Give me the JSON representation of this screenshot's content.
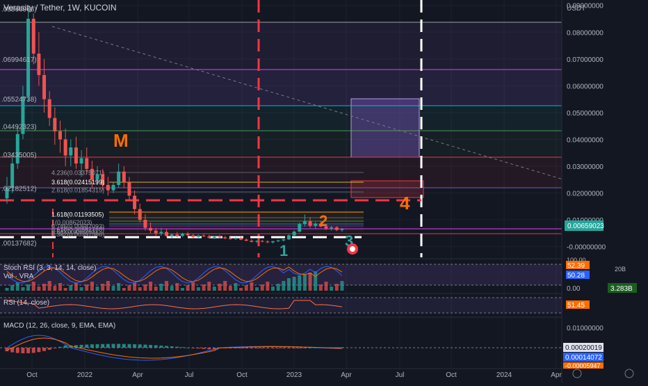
{
  "header": {
    "title": "Verasity / Tether, 1W, KUCOIN",
    "currency": "USDT"
  },
  "colors": {
    "bg": "#131722",
    "grid": "#1e222d",
    "up": "#26a69a",
    "down": "#ef5350",
    "text": "#b2b5be",
    "purple": "#7e57c2",
    "orange": "#ff9800",
    "red": "#f23645",
    "white": "#ffffff",
    "green": "#4caf50",
    "blueLine": "#2962ff",
    "macdSignal": "#ff6d00"
  },
  "left_labels": [
    {
      "text": ".08866963)",
      "price": 0.0887
    },
    {
      "text": ".06994617)",
      "price": 0.07
    },
    {
      "text": ".05524738)",
      "price": 0.0552
    },
    {
      "text": ".04492323)",
      "price": 0.0449
    },
    {
      "text": ".03435005)",
      "price": 0.0344
    },
    {
      "text": ".02182512)",
      "price": 0.0218
    },
    {
      "text": ".00137682)",
      "price": 0.0014
    }
  ],
  "fib_labels": [
    {
      "text": "4.236(0.03375071)",
      "price": 0.0275
    },
    {
      "text": "3.618(0.02415199)",
      "price": 0.024
    },
    {
      "text": "2.618(0.01854315)",
      "price": 0.021
    },
    {
      "text": "1.618(0.01193505)",
      "price": 0.0119
    },
    {
      "text": "1(0.00862023)",
      "price": 0.009
    },
    {
      "text": "0.786(0.00687093)",
      "price": 0.0075
    },
    {
      "text": "0.618(0.00582798)",
      "price": 0.0064
    },
    {
      "text": "0.5(0.00490203)",
      "price": 0.0055
    },
    {
      "text": "0.382(0.00397598)",
      "price": 0.0045
    }
  ],
  "annotations": {
    "m": "M",
    "n1": "1",
    "n2": "2",
    "n3": "3",
    "n4": "4"
  },
  "price_axis": {
    "ticks": [
      "0.09000000",
      "0.08000000",
      "0.07000000",
      "0.06000000",
      "0.05000000",
      "0.04000000",
      "0.03000000",
      "0.02000000",
      "0.01000000",
      "-0.00000000"
    ],
    "last_price": "0.00659023"
  },
  "time_axis": [
    "Oct",
    "2022",
    "Apr",
    "Jul",
    "Oct",
    "2023",
    "Apr",
    "Jul",
    "Oct",
    "2024",
    "Apr"
  ],
  "indicators": {
    "stoch_label": "Stoch RSI (3, 3, 14, 14, close)",
    "stoch_top": "100.00",
    "stoch_k": "52.39",
    "stoch_d": "50.28",
    "vol_label": "Vol · VRA",
    "vol_scale": "20B",
    "vol_zero": "0.00",
    "vol_value": "3.283B",
    "rsi_label": "RSI (14, close)",
    "rsi_value": "51.45",
    "macd_label": "MACD (12, 26, close, 9, EMA, EMA)",
    "macd_scale": "0.01000000",
    "macd_v1": "0.00020019",
    "macd_v2": "0.00014072",
    "macd_v3": "-0.00005947"
  },
  "chart_data": {
    "type": "candlestick",
    "title": "Verasity / Tether, 1W, KUCOIN",
    "ylabel": "USDT",
    "ylim": [
      -0.004,
      0.092
    ],
    "x_range": [
      "2021-09",
      "2024-04"
    ],
    "candles": [
      [
        0.018,
        0.026,
        0.016,
        0.022
      ],
      [
        0.022,
        0.035,
        0.02,
        0.031
      ],
      [
        0.031,
        0.045,
        0.029,
        0.042
      ],
      [
        0.042,
        0.06,
        0.04,
        0.056
      ],
      [
        0.056,
        0.089,
        0.054,
        0.085
      ],
      [
        0.085,
        0.087,
        0.068,
        0.072
      ],
      [
        0.072,
        0.08,
        0.06,
        0.064
      ],
      [
        0.064,
        0.07,
        0.05,
        0.055
      ],
      [
        0.055,
        0.058,
        0.045,
        0.048
      ],
      [
        0.048,
        0.052,
        0.038,
        0.043
      ],
      [
        0.043,
        0.047,
        0.035,
        0.04
      ],
      [
        0.04,
        0.044,
        0.03,
        0.034
      ],
      [
        0.034,
        0.04,
        0.03,
        0.037
      ],
      [
        0.037,
        0.041,
        0.029,
        0.031
      ],
      [
        0.031,
        0.036,
        0.026,
        0.033
      ],
      [
        0.033,
        0.037,
        0.027,
        0.029
      ],
      [
        0.029,
        0.032,
        0.022,
        0.025
      ],
      [
        0.025,
        0.03,
        0.023,
        0.027
      ],
      [
        0.027,
        0.029,
        0.021,
        0.023
      ],
      [
        0.023,
        0.026,
        0.019,
        0.021
      ],
      [
        0.021,
        0.024,
        0.02,
        0.023
      ],
      [
        0.023,
        0.031,
        0.022,
        0.028
      ],
      [
        0.028,
        0.03,
        0.022,
        0.024
      ],
      [
        0.024,
        0.026,
        0.017,
        0.019
      ],
      [
        0.019,
        0.021,
        0.012,
        0.014
      ],
      [
        0.014,
        0.016,
        0.009,
        0.01
      ],
      [
        0.01,
        0.012,
        0.006,
        0.007
      ],
      [
        0.007,
        0.009,
        0.005,
        0.006
      ],
      [
        0.006,
        0.007,
        0.004,
        0.005
      ],
      [
        0.005,
        0.007,
        0.004,
        0.0055
      ],
      [
        0.0055,
        0.0065,
        0.0035,
        0.004
      ],
      [
        0.004,
        0.005,
        0.003,
        0.0045
      ],
      [
        0.0045,
        0.0055,
        0.0035,
        0.004
      ],
      [
        0.004,
        0.0052,
        0.0035,
        0.0048
      ],
      [
        0.0048,
        0.0055,
        0.004,
        0.0042
      ],
      [
        0.0042,
        0.0048,
        0.0032,
        0.0036
      ],
      [
        0.0036,
        0.0045,
        0.003,
        0.0041
      ],
      [
        0.0041,
        0.0047,
        0.0036,
        0.0038
      ],
      [
        0.0038,
        0.0044,
        0.0031,
        0.0033
      ],
      [
        0.0033,
        0.004,
        0.0029,
        0.0037
      ],
      [
        0.0037,
        0.0043,
        0.0032,
        0.0035
      ],
      [
        0.0035,
        0.004,
        0.0028,
        0.0031
      ],
      [
        0.0031,
        0.0036,
        0.0026,
        0.0029
      ],
      [
        0.0029,
        0.0035,
        0.0025,
        0.0032
      ],
      [
        0.0032,
        0.0036,
        0.0024,
        0.0026
      ],
      [
        0.0026,
        0.0031,
        0.002,
        0.0022
      ],
      [
        0.0022,
        0.0027,
        0.0015,
        0.0018
      ],
      [
        0.0018,
        0.0024,
        0.0014,
        0.0021
      ],
      [
        0.0021,
        0.0025,
        0.0016,
        0.0019
      ],
      [
        0.0019,
        0.0024,
        0.0013,
        0.0016
      ],
      [
        0.0016,
        0.0022,
        0.0012,
        0.002
      ],
      [
        0.002,
        0.0026,
        0.0017,
        0.0023
      ],
      [
        0.0023,
        0.0029,
        0.0019,
        0.0027
      ],
      [
        0.0027,
        0.0045,
        0.0025,
        0.0042
      ],
      [
        0.0042,
        0.006,
        0.0038,
        0.0056
      ],
      [
        0.0056,
        0.009,
        0.0052,
        0.0085
      ],
      [
        0.0085,
        0.012,
        0.0075,
        0.0095
      ],
      [
        0.0095,
        0.011,
        0.007,
        0.0078
      ],
      [
        0.0078,
        0.0092,
        0.0068,
        0.0086
      ],
      [
        0.0086,
        0.0095,
        0.0072,
        0.0075
      ],
      [
        0.0075,
        0.0082,
        0.0062,
        0.0068
      ],
      [
        0.0068,
        0.0078,
        0.006,
        0.0072
      ],
      [
        0.0072,
        0.0076,
        0.0058,
        0.0062
      ],
      [
        0.0062,
        0.007,
        0.0055,
        0.00659
      ]
    ]
  }
}
